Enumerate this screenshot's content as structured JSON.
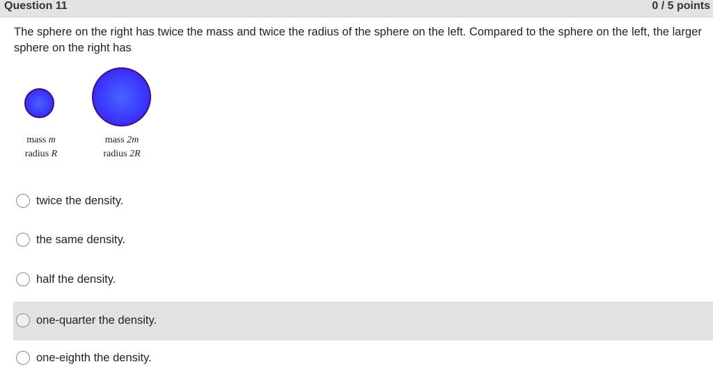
{
  "header": {
    "question_title": "Question 11",
    "points": "0 / 5 points"
  },
  "question": {
    "prompt": "The sphere on the right has twice the mass and twice the radius of the sphere on the left. Compared to the sphere on the left, the larger sphere on the right has"
  },
  "figure": {
    "left_sphere": {
      "mass_word": "mass",
      "mass_var": "m",
      "radius_word": "radius",
      "radius_var": "R"
    },
    "right_sphere": {
      "mass_word": "mass",
      "mass_var": "2m",
      "radius_word": "radius",
      "radius_var": "2R"
    },
    "sphere_color": "#3a3aff"
  },
  "options": [
    {
      "label": "twice the density.",
      "highlighted": false
    },
    {
      "label": "the same density.",
      "highlighted": false
    },
    {
      "label": "half the density.",
      "highlighted": false
    },
    {
      "label": "one-quarter the density.",
      "highlighted": true
    },
    {
      "label": "one-eighth the density.",
      "highlighted": false
    }
  ]
}
